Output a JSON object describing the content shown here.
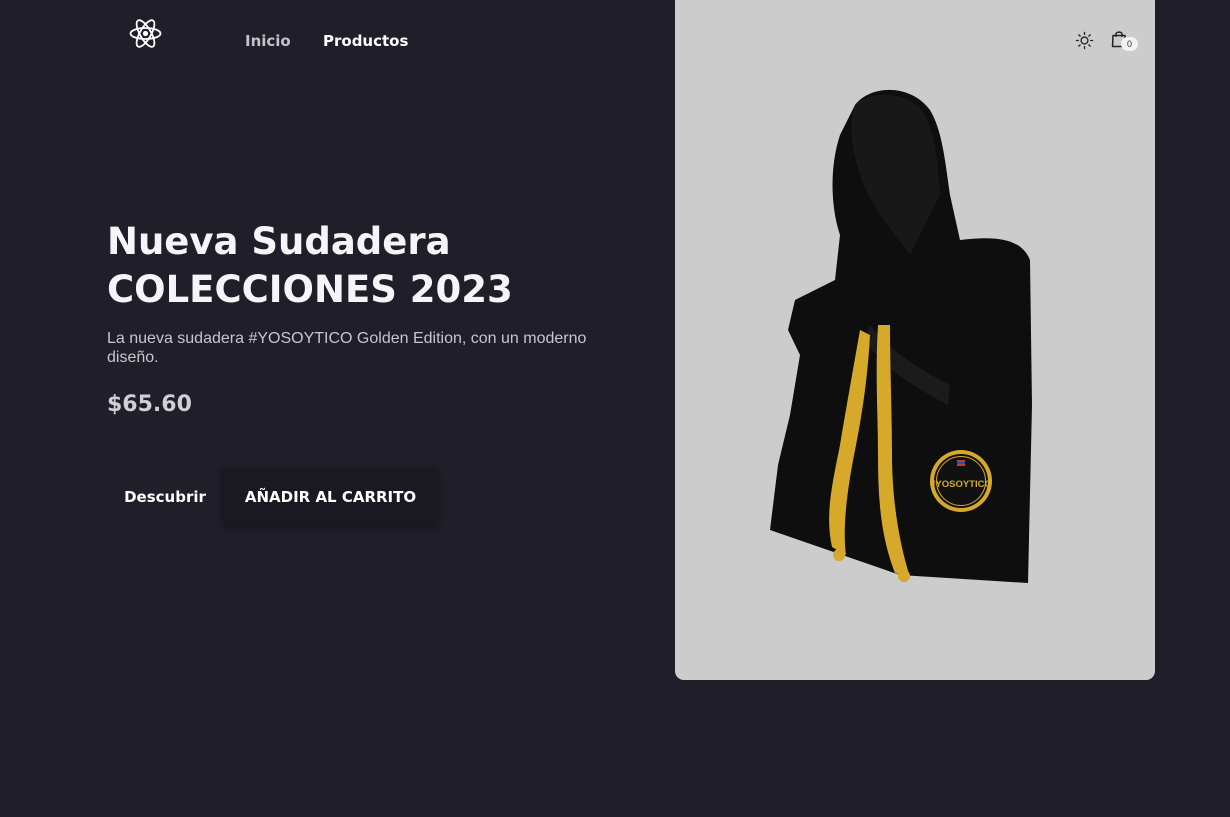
{
  "header": {
    "logo_icon": "react-atom-icon",
    "nav": {
      "home_label": "Inicio",
      "products_label": "Productos"
    },
    "theme_icon": "sun-icon",
    "cart_icon": "shopping-bag-icon",
    "cart_count": "0"
  },
  "hero": {
    "title_line1": "Nueva Sudadera",
    "title_line2": "COLECCIONES 2023",
    "description": "La nueva sudadera #YOSOYTICO Golden Edition, con un moderno diseño.",
    "price": "$65.60",
    "discover_label": "Descubrir",
    "add_to_cart_label": "AÑADIR AL CARRITO"
  },
  "product_image": {
    "badge_text": "#YOSOYTICO",
    "colors": {
      "hoodie": "#0e0e0e",
      "drawstring": "#d6a92a",
      "background": "#cccccc"
    }
  },
  "colors": {
    "page_background": "#1f1e29",
    "button_background": "#1a1921"
  }
}
